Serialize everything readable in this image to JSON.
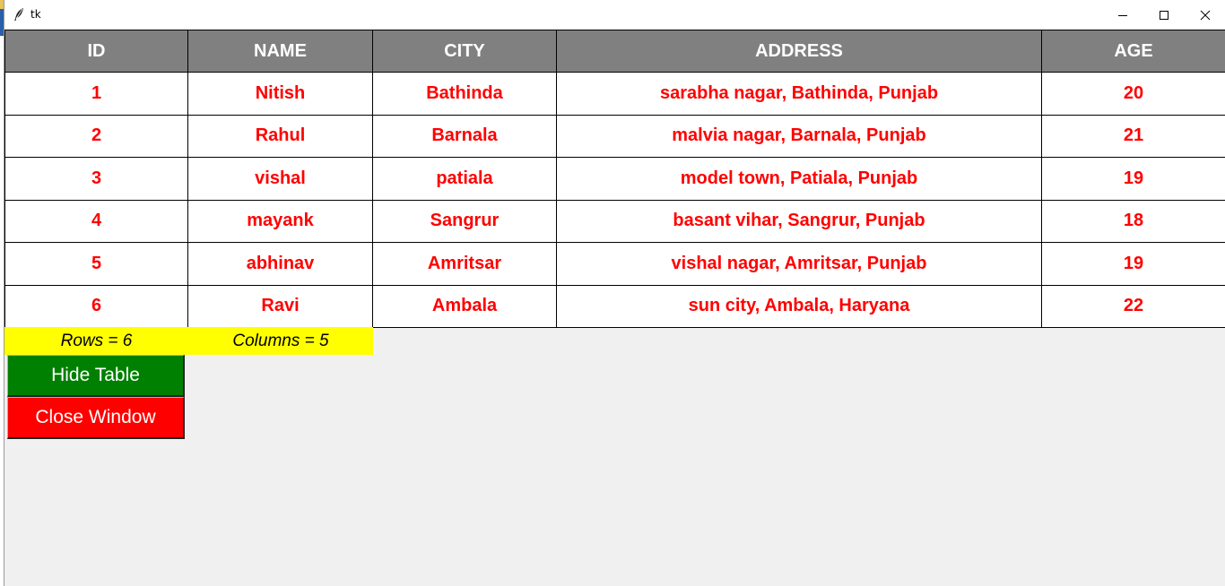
{
  "window": {
    "title": "tk",
    "controls": {
      "minimize": "minimize-icon",
      "maximize": "maximize-icon",
      "close": "close-icon"
    }
  },
  "table": {
    "headers": [
      "ID",
      "NAME",
      "CITY",
      "ADDRESS",
      "AGE"
    ],
    "rows": [
      [
        "1",
        "Nitish",
        "Bathinda",
        "sarabha nagar, Bathinda, Punjab",
        "20"
      ],
      [
        "2",
        "Rahul",
        "Barnala",
        "malvia nagar, Barnala, Punjab",
        "21"
      ],
      [
        "3",
        "vishal",
        "patiala",
        "model town, Patiala, Punjab",
        "19"
      ],
      [
        "4",
        "mayank",
        "Sangrur",
        "basant vihar, Sangrur, Punjab",
        "18"
      ],
      [
        "5",
        "abhinav",
        "Amritsar",
        "vishal nagar, Amritsar, Punjab",
        "19"
      ],
      [
        "6",
        "Ravi",
        "Ambala",
        "sun city, Ambala, Haryana",
        "22"
      ]
    ],
    "header_bg": "#808080",
    "header_fg": "#ffffff",
    "cell_fg": "#ff0000"
  },
  "info": {
    "rows_label": "Rows = 6",
    "columns_label": "Columns = 5",
    "bg": "#ffff00"
  },
  "buttons": {
    "hide_table": "Hide Table",
    "close_window": "Close Window",
    "hide_bg": "#008000",
    "close_bg": "#ff0000"
  }
}
